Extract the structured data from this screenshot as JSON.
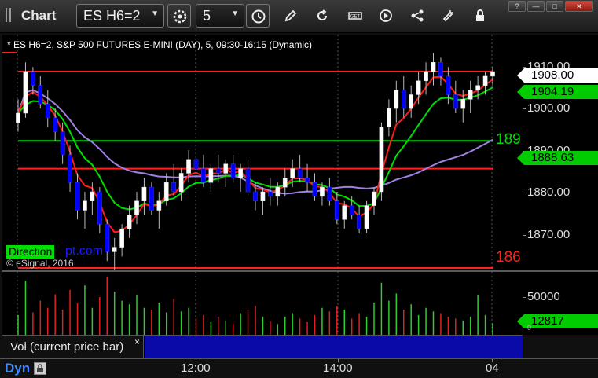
{
  "toolbar": {
    "title": "Chart",
    "symbol": "ES H6=2",
    "interval": "5",
    "icons": [
      "settings-icon",
      "clock-icon",
      "pencil-icon",
      "refresh-icon",
      "get-data-icon",
      "play-icon",
      "network-icon",
      "cursor-icon",
      "lock-icon"
    ]
  },
  "window_buttons": {
    "help": "?",
    "minimize": "—",
    "restore": "□",
    "close": "✕"
  },
  "chart": {
    "description": "* ES H6=2, S&P 500 FUTURES E-MINI (DAY), 5, 09:30-16:15 (Dynamic)",
    "copyright": "© eSignal, 2016",
    "direction_label": "Direction",
    "watermark": "pt.com",
    "label_upper": "189",
    "label_lower": "186",
    "price_ticks": [
      "1910.00",
      "1900.00",
      "1890.00",
      "1880.00",
      "1870.00"
    ],
    "last_price_tag": "1908.00",
    "ma_fast_tag": "1904.19",
    "ma_slow_tag": "1888.63",
    "vol_tick": "50000",
    "vol_tag": "12817",
    "vol_zero": "0",
    "colors": {
      "up": "#ffffff",
      "down": "#0000ff",
      "ma_red": "#ff1a1a",
      "ma_green": "#00dd00",
      "ma_purple": "#a080e0",
      "level_red": "#ff2020",
      "level_green": "#00dd00"
    }
  },
  "vol_input": {
    "label": "Vol (current price bar)",
    "close": "×"
  },
  "time_axis": {
    "corner_label": "Dyn",
    "ticks": [
      "12:00",
      "14:00",
      "04"
    ]
  },
  "chart_data": {
    "type": "candlestick",
    "price_range": [
      1865,
      1916
    ],
    "volume_range": [
      0,
      70000
    ],
    "horizontal_levels": [
      {
        "price": 1908.0,
        "color": "red"
      },
      {
        "price": 1893.0,
        "color": "green"
      },
      {
        "price": 1887.0,
        "color": "red"
      },
      {
        "price": 1865.5,
        "color": "red"
      }
    ],
    "candles": [
      [
        1897,
        1902,
        1895,
        1899
      ],
      [
        1899,
        1910,
        1898,
        1908
      ],
      [
        1908,
        1909,
        1903,
        1905
      ],
      [
        1905,
        1907,
        1900,
        1901
      ],
      [
        1901,
        1904,
        1896,
        1898
      ],
      [
        1898,
        1900,
        1893,
        1895
      ],
      [
        1895,
        1897,
        1888,
        1890
      ],
      [
        1890,
        1892,
        1882,
        1884
      ],
      [
        1884,
        1886,
        1876,
        1878
      ],
      [
        1878,
        1882,
        1874,
        1880
      ],
      [
        1880,
        1884,
        1877,
        1882
      ],
      [
        1882,
        1883,
        1873,
        1875
      ],
      [
        1875,
        1876,
        1867,
        1869
      ],
      [
        1869,
        1872,
        1865,
        1870
      ],
      [
        1870,
        1875,
        1868,
        1874
      ],
      [
        1874,
        1879,
        1872,
        1877
      ],
      [
        1877,
        1882,
        1875,
        1880
      ],
      [
        1880,
        1885,
        1877,
        1883
      ],
      [
        1883,
        1884,
        1877,
        1878
      ],
      [
        1878,
        1882,
        1874,
        1880
      ],
      [
        1880,
        1886,
        1879,
        1884
      ],
      [
        1884,
        1888,
        1881,
        1882
      ],
      [
        1882,
        1887,
        1880,
        1886
      ],
      [
        1886,
        1891,
        1884,
        1889
      ],
      [
        1889,
        1892,
        1885,
        1887
      ],
      [
        1887,
        1890,
        1883,
        1884
      ],
      [
        1884,
        1888,
        1882,
        1887
      ],
      [
        1887,
        1890,
        1884,
        1886
      ],
      [
        1886,
        1889,
        1883,
        1888
      ],
      [
        1888,
        1890,
        1884,
        1885
      ],
      [
        1885,
        1888,
        1882,
        1887
      ],
      [
        1887,
        1889,
        1881,
        1882
      ],
      [
        1882,
        1884,
        1878,
        1880
      ],
      [
        1880,
        1883,
        1877,
        1882
      ],
      [
        1882,
        1885,
        1879,
        1881
      ],
      [
        1881,
        1884,
        1879,
        1883
      ],
      [
        1883,
        1887,
        1881,
        1885
      ],
      [
        1885,
        1889,
        1883,
        1887
      ],
      [
        1887,
        1890,
        1884,
        1885
      ],
      [
        1885,
        1888,
        1882,
        1884
      ],
      [
        1884,
        1886,
        1880,
        1881
      ],
      [
        1881,
        1884,
        1879,
        1883
      ],
      [
        1883,
        1885,
        1879,
        1880
      ],
      [
        1880,
        1882,
        1875,
        1876
      ],
      [
        1876,
        1880,
        1874,
        1879
      ],
      [
        1879,
        1881,
        1876,
        1877
      ],
      [
        1877,
        1879,
        1873,
        1874
      ],
      [
        1874,
        1880,
        1873,
        1879
      ],
      [
        1879,
        1883,
        1877,
        1882
      ],
      [
        1882,
        1897,
        1880,
        1896
      ],
      [
        1896,
        1902,
        1894,
        1900
      ],
      [
        1900,
        1906,
        1897,
        1904
      ],
      [
        1904,
        1907,
        1898,
        1900
      ],
      [
        1900,
        1905,
        1898,
        1903
      ],
      [
        1903,
        1908,
        1901,
        1906
      ],
      [
        1906,
        1910,
        1903,
        1908
      ],
      [
        1908,
        1912,
        1905,
        1910
      ],
      [
        1910,
        1911,
        1905,
        1907
      ],
      [
        1907,
        1909,
        1901,
        1903
      ],
      [
        1903,
        1906,
        1899,
        1900
      ],
      [
        1900,
        1904,
        1897,
        1902
      ],
      [
        1902,
        1906,
        1899,
        1904
      ],
      [
        1904,
        1907,
        1902,
        1905
      ],
      [
        1905,
        1908,
        1903,
        1907
      ],
      [
        1907,
        1909,
        1905,
        1908
      ]
    ],
    "volumes": [
      22000,
      60000,
      25000,
      38000,
      30000,
      45000,
      28000,
      50000,
      35000,
      55000,
      30000,
      42000,
      65000,
      48000,
      38000,
      34000,
      44000,
      30000,
      28000,
      36000,
      25000,
      40000,
      26000,
      30000,
      18000,
      22000,
      14000,
      20000,
      16000,
      12000,
      24000,
      28000,
      32000,
      20000,
      15000,
      12000,
      20000,
      24000,
      18000,
      14000,
      22000,
      30000,
      26000,
      32000,
      28000,
      18000,
      24000,
      20000,
      36000,
      58000,
      38000,
      46000,
      28000,
      34000,
      22000,
      30000,
      26000,
      24000,
      20000,
      18000,
      16000,
      20000,
      44000,
      22000,
      12817
    ]
  }
}
